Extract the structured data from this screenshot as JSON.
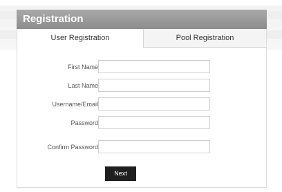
{
  "header": {
    "title": "Registration"
  },
  "tabs": [
    {
      "label": "User Registration",
      "active": true
    },
    {
      "label": "Pool Registration",
      "active": false
    }
  ],
  "form": {
    "separator": ":",
    "fields": [
      {
        "label": "First Name",
        "value": ""
      },
      {
        "label": "Last Name",
        "value": ""
      },
      {
        "label": "Username/Email",
        "value": ""
      },
      {
        "label": "Password",
        "value": ""
      },
      {
        "label": "Confirm Password",
        "value": ""
      }
    ],
    "submit_label": "Next"
  }
}
